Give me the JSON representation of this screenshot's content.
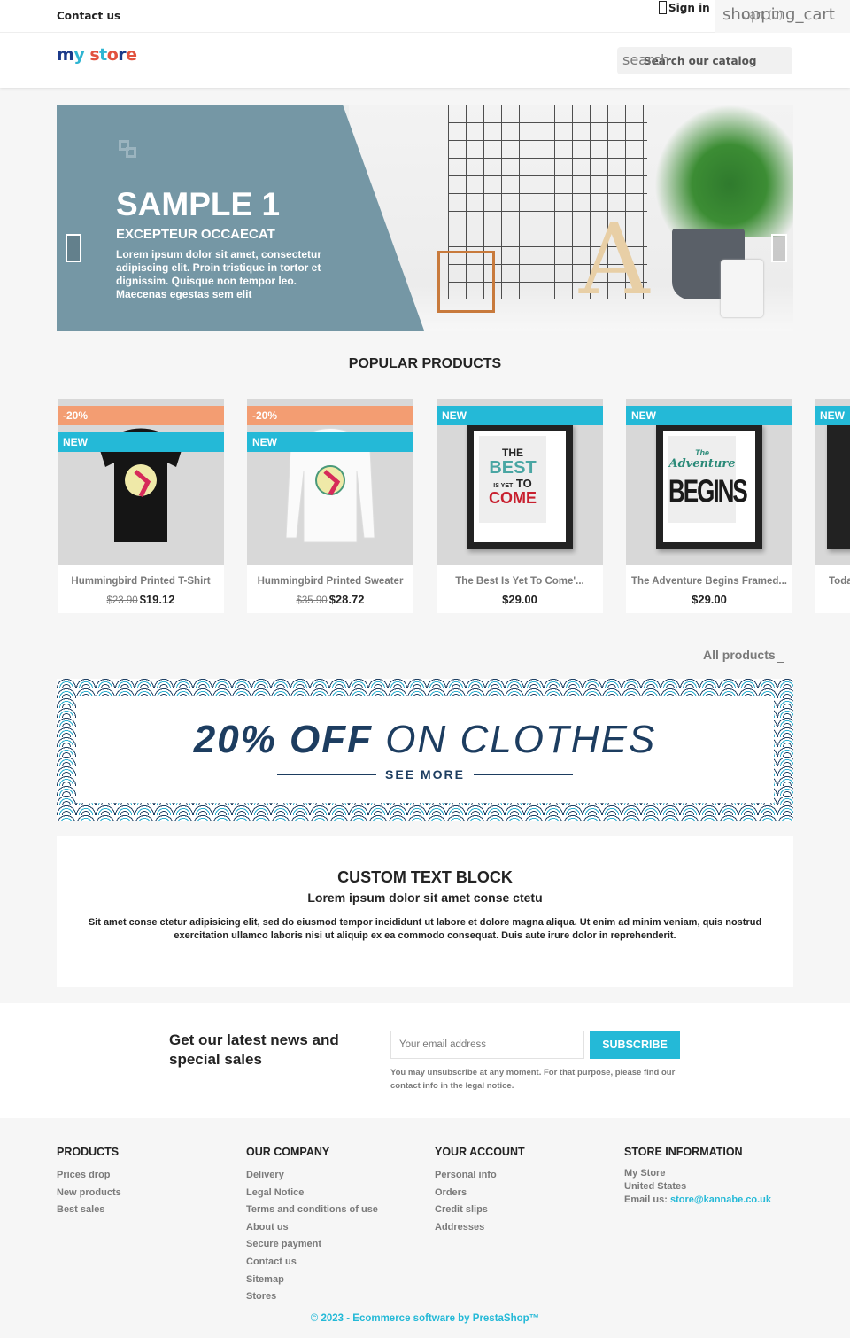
{
  "header": {
    "contact_label": "Contact us",
    "signin_label": "Sign in",
    "cart_icon_text": "shopping_cart",
    "cart_label": "Cart (0)",
    "logo_letters": [
      "m",
      "y",
      " ",
      "s",
      "t",
      "o",
      "r",
      "e"
    ],
    "logo_text": "my store",
    "search_icon_text": "search",
    "search_placeholder": "Search our catalog"
  },
  "slider": {
    "title": "SAMPLE 1",
    "subtitle": "EXCEPTEUR OCCAECAT",
    "text": "Lorem ipsum dolor sit amet, consectetur adipiscing elit. Proin tristique in tortor et dignissim. Quisque non tempor leo. Maecenas egestas sem elit",
    "panel_color": "#7597a5"
  },
  "popular": {
    "title": "POPULAR PRODUCTS",
    "all_products_label": "All products",
    "products": [
      {
        "name": "Hummingbird Printed T-Shirt",
        "old_price": "$23.90",
        "price": "$19.12",
        "flags": [
          "-20%",
          "NEW"
        ]
      },
      {
        "name": "Hummingbird Printed Sweater",
        "old_price": "$35.90",
        "price": "$28.72",
        "flags": [
          "-20%",
          "NEW"
        ]
      },
      {
        "name": "The Best Is Yet To Come'...",
        "old_price": null,
        "price": "$29.00",
        "flags": [
          "NEW"
        ]
      },
      {
        "name": "The Adventure Begins Framed...",
        "old_price": null,
        "price": "$29.00",
        "flags": [
          "NEW"
        ]
      },
      {
        "name": "Toda",
        "old_price": null,
        "price": "",
        "flags": [
          "NEW"
        ]
      }
    ],
    "poster1": {
      "l1": "THE",
      "l2": "BEST",
      "l3a": "IS YET",
      "l3b": "TO",
      "l4": "COME"
    },
    "poster2": {
      "l1": "The",
      "l2": "Adventure",
      "l3": "BEGINS"
    }
  },
  "promo": {
    "headline_bold": "20% OFF",
    "headline_rest": "ON CLOTHES",
    "cta": "SEE MORE"
  },
  "custom_block": {
    "title": "CUSTOM TEXT BLOCK",
    "subtitle": "Lorem ipsum dolor sit amet conse ctetu",
    "body": "Sit amet conse ctetur adipisicing elit, sed do eiusmod tempor incididunt ut labore et dolore magna aliqua. Ut enim ad minim veniam, quis nostrud exercitation ullamco laboris nisi ut aliquip ex ea commodo consequat. Duis aute irure dolor in reprehenderit."
  },
  "newsletter": {
    "title": "Get our latest news and special sales",
    "email_placeholder": "Your email address",
    "subscribe_label": "SUBSCRIBE",
    "note": "You may unsubscribe at any moment. For that purpose, please find our contact info in the legal notice."
  },
  "footer": {
    "columns": [
      {
        "title": "PRODUCTS",
        "links": [
          "Prices drop",
          "New products",
          "Best sales"
        ]
      },
      {
        "title": "OUR COMPANY",
        "links": [
          "Delivery",
          "Legal Notice",
          "Terms and conditions of use",
          "About us",
          "Secure payment",
          "Contact us",
          "Sitemap",
          "Stores"
        ]
      },
      {
        "title": "YOUR ACCOUNT",
        "links": [
          "Personal info",
          "Orders",
          "Credit slips",
          "Addresses"
        ]
      }
    ],
    "store_info": {
      "title": "STORE INFORMATION",
      "name": "My Store",
      "country": "United States",
      "email_label": "Email us: ",
      "email": "store@kannabe.co.uk"
    },
    "copyright": "© 2023 - Ecommerce software by PrestaShop™"
  },
  "colors": {
    "accent": "#24b9d7",
    "discount_flag": "#f39d72",
    "promo_navy": "#1d3d60"
  }
}
